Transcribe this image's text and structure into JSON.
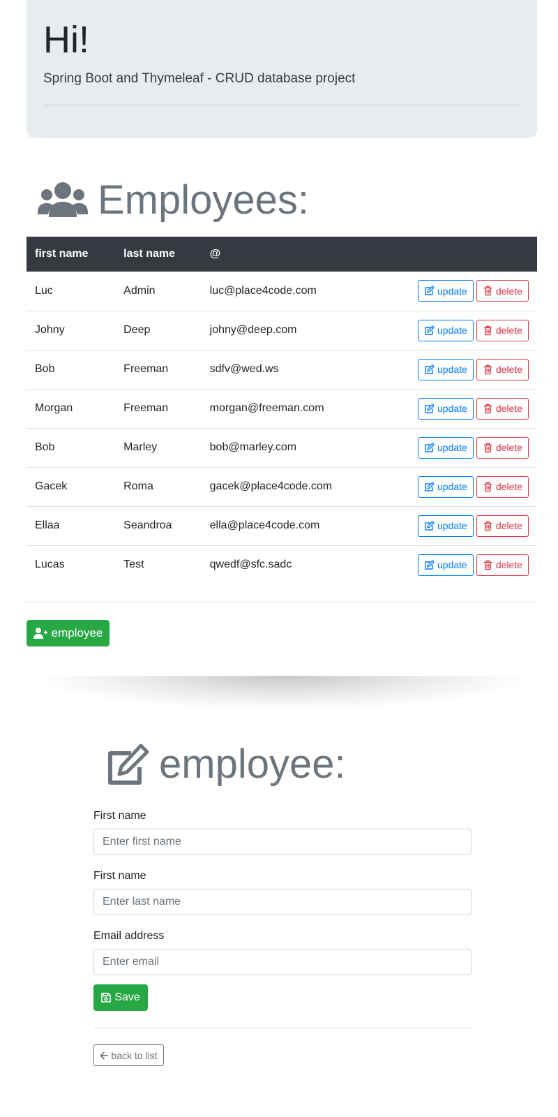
{
  "header": {
    "title": "Hi!",
    "subtitle": "Spring Boot and Thymeleaf - CRUD database project"
  },
  "employees_section": {
    "heading": "Employees:",
    "icon": "users-icon",
    "columns": [
      "first name",
      "last name",
      "@"
    ],
    "rows": [
      {
        "first": "Luc",
        "last": "Admin",
        "email": "luc@place4code.com"
      },
      {
        "first": "Johny",
        "last": "Deep",
        "email": "johny@deep.com"
      },
      {
        "first": "Bob",
        "last": "Freeman",
        "email": "sdfv@wed.ws"
      },
      {
        "first": "Morgan",
        "last": "Freeman",
        "email": "morgan@freeman.com"
      },
      {
        "first": "Bob",
        "last": "Marley",
        "email": "bob@marley.com"
      },
      {
        "first": "Gacek",
        "last": "Roma",
        "email": "gacek@place4code.com"
      },
      {
        "first": "Ellaa",
        "last": "Seandroa",
        "email": "ella@place4code.com"
      },
      {
        "first": "Lucas",
        "last": "Test",
        "email": "qwedf@sfc.sadc"
      }
    ],
    "update_label": "update",
    "delete_label": "delete",
    "add_label": "employee"
  },
  "form": {
    "heading": "employee:",
    "icon": "edit-icon",
    "first_name_label": "First name",
    "first_name_placeholder": "Enter first name",
    "last_name_label": "First name",
    "last_name_placeholder": "Enter last name",
    "email_label": "Email address",
    "email_placeholder": "Enter email",
    "save_label": "Save",
    "back_label": "back to list"
  },
  "colors": {
    "primary": "#007bff",
    "danger": "#dc3545",
    "success": "#28a745",
    "dark": "#343a40",
    "muted": "#6c757d",
    "jumbotron": "#e9ecef"
  }
}
